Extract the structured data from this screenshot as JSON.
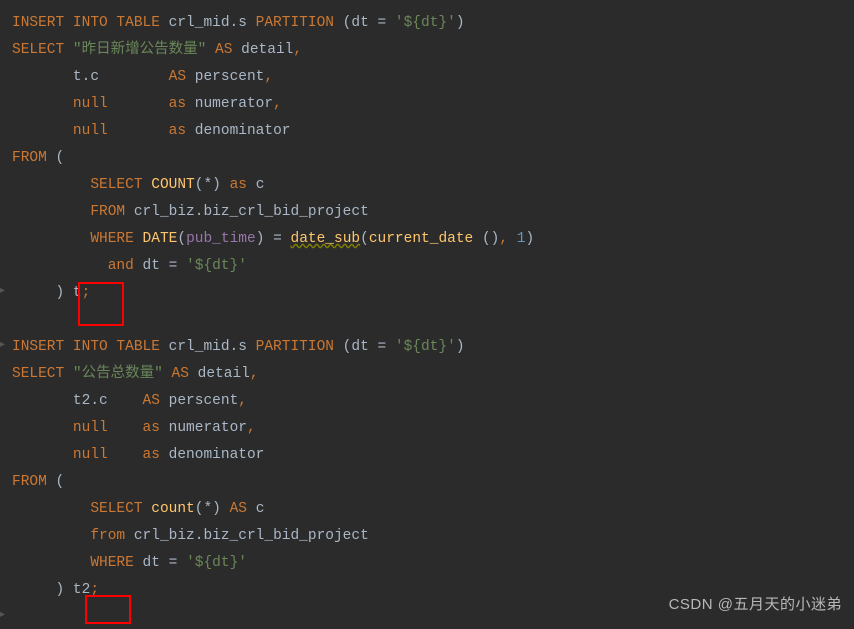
{
  "lines": {
    "l1": {
      "kw1": "INSERT INTO TABLE",
      "tbl": " crl_mid.s ",
      "kw2": "PARTITION ",
      "paren1": "(dt = ",
      "str1": "'${dt}'",
      "paren2": ")"
    },
    "l2": {
      "kw": "SELECT ",
      "str": "\"昨日新增公告数量\"",
      "as": " AS ",
      "col": "detail",
      "comma": ","
    },
    "l3": {
      "indent": "       ",
      "val": "t.c",
      "pad": "        ",
      "as": "AS ",
      "col": "perscent",
      "comma": ","
    },
    "l4": {
      "indent": "       ",
      "val": "null",
      "pad": "       ",
      "as": "as ",
      "col": "numerator",
      "comma": ","
    },
    "l5": {
      "indent": "       ",
      "val": "null",
      "pad": "       ",
      "as": "as ",
      "col": "denominator"
    },
    "l6": {
      "kw": "FROM ",
      "paren": "("
    },
    "l7": {
      "indent": "         ",
      "kw": "SELECT ",
      "fn": "COUNT",
      "args": "(*) ",
      "as": "as ",
      "col": "c"
    },
    "l8": {
      "indent": "         ",
      "kw": "FROM ",
      "tbl": "crl_biz.biz_crl_bid_project"
    },
    "l9": {
      "indent": "         ",
      "kw": "WHERE ",
      "fn1": "DATE",
      "p1": "(",
      "arg1": "pub_time",
      "p2": ") = ",
      "fn2": "date_sub",
      "p3": "(",
      "fn3": "current_date ",
      "p4": "()",
      "comma": ", ",
      "num": "1",
      "p5": ")"
    },
    "l10": {
      "indent": "           ",
      "kw": "and ",
      "col": "dt = ",
      "str": "'${dt}'"
    },
    "l11": {
      "indent": "     ",
      "close": ") ",
      "alias": "t",
      "semi": ";"
    },
    "l12": {
      "blank": ""
    },
    "l13": {
      "kw1": "INSERT INTO TABLE",
      "tbl": " crl_mid.s ",
      "kw2": "PARTITION ",
      "paren1": "(dt = ",
      "str1": "'${dt}'",
      "paren2": ")"
    },
    "l14": {
      "kw": "SELECT ",
      "str": "\"公告总数量\"",
      "as": " AS ",
      "col": "detail",
      "comma": ","
    },
    "l15": {
      "indent": "       ",
      "val": "t2.c",
      "pad": "    ",
      "as": "AS ",
      "col": "perscent",
      "comma": ","
    },
    "l16": {
      "indent": "       ",
      "val": "null",
      "pad": "    ",
      "as": "as ",
      "col": "numerator",
      "comma": ","
    },
    "l17": {
      "indent": "       ",
      "val": "null",
      "pad": "    ",
      "as": "as ",
      "col": "denominator"
    },
    "l18": {
      "kw": "FROM ",
      "paren": "("
    },
    "l19": {
      "indent": "         ",
      "kw": "SELECT ",
      "fn": "count",
      "args": "(*) ",
      "as": "AS ",
      "col": "c"
    },
    "l20": {
      "indent": "         ",
      "kw": "from ",
      "tbl": "crl_biz.biz_crl_bid_project"
    },
    "l21": {
      "indent": "         ",
      "kw": "WHERE ",
      "col": "dt = ",
      "str": "'${dt}'"
    },
    "l22": {
      "indent": "     ",
      "close": ") ",
      "alias": "t2",
      "semi": ";"
    }
  },
  "watermark": "CSDN @五月天的小迷弟"
}
